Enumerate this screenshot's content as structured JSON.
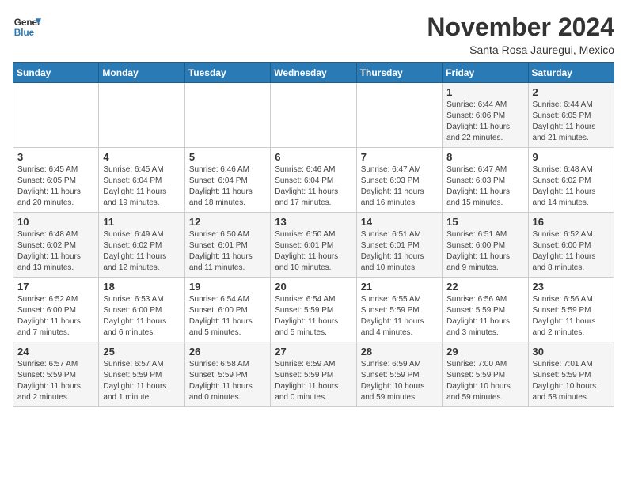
{
  "logo": {
    "general": "General",
    "blue": "Blue"
  },
  "title": "November 2024",
  "location": "Santa Rosa Jauregui, Mexico",
  "headers": [
    "Sunday",
    "Monday",
    "Tuesday",
    "Wednesday",
    "Thursday",
    "Friday",
    "Saturday"
  ],
  "weeks": [
    [
      {
        "day": "",
        "info": ""
      },
      {
        "day": "",
        "info": ""
      },
      {
        "day": "",
        "info": ""
      },
      {
        "day": "",
        "info": ""
      },
      {
        "day": "",
        "info": ""
      },
      {
        "day": "1",
        "info": "Sunrise: 6:44 AM\nSunset: 6:06 PM\nDaylight: 11 hours\nand 22 minutes."
      },
      {
        "day": "2",
        "info": "Sunrise: 6:44 AM\nSunset: 6:05 PM\nDaylight: 11 hours\nand 21 minutes."
      }
    ],
    [
      {
        "day": "3",
        "info": "Sunrise: 6:45 AM\nSunset: 6:05 PM\nDaylight: 11 hours\nand 20 minutes."
      },
      {
        "day": "4",
        "info": "Sunrise: 6:45 AM\nSunset: 6:04 PM\nDaylight: 11 hours\nand 19 minutes."
      },
      {
        "day": "5",
        "info": "Sunrise: 6:46 AM\nSunset: 6:04 PM\nDaylight: 11 hours\nand 18 minutes."
      },
      {
        "day": "6",
        "info": "Sunrise: 6:46 AM\nSunset: 6:04 PM\nDaylight: 11 hours\nand 17 minutes."
      },
      {
        "day": "7",
        "info": "Sunrise: 6:47 AM\nSunset: 6:03 PM\nDaylight: 11 hours\nand 16 minutes."
      },
      {
        "day": "8",
        "info": "Sunrise: 6:47 AM\nSunset: 6:03 PM\nDaylight: 11 hours\nand 15 minutes."
      },
      {
        "day": "9",
        "info": "Sunrise: 6:48 AM\nSunset: 6:02 PM\nDaylight: 11 hours\nand 14 minutes."
      }
    ],
    [
      {
        "day": "10",
        "info": "Sunrise: 6:48 AM\nSunset: 6:02 PM\nDaylight: 11 hours\nand 13 minutes."
      },
      {
        "day": "11",
        "info": "Sunrise: 6:49 AM\nSunset: 6:02 PM\nDaylight: 11 hours\nand 12 minutes."
      },
      {
        "day": "12",
        "info": "Sunrise: 6:50 AM\nSunset: 6:01 PM\nDaylight: 11 hours\nand 11 minutes."
      },
      {
        "day": "13",
        "info": "Sunrise: 6:50 AM\nSunset: 6:01 PM\nDaylight: 11 hours\nand 10 minutes."
      },
      {
        "day": "14",
        "info": "Sunrise: 6:51 AM\nSunset: 6:01 PM\nDaylight: 11 hours\nand 10 minutes."
      },
      {
        "day": "15",
        "info": "Sunrise: 6:51 AM\nSunset: 6:00 PM\nDaylight: 11 hours\nand 9 minutes."
      },
      {
        "day": "16",
        "info": "Sunrise: 6:52 AM\nSunset: 6:00 PM\nDaylight: 11 hours\nand 8 minutes."
      }
    ],
    [
      {
        "day": "17",
        "info": "Sunrise: 6:52 AM\nSunset: 6:00 PM\nDaylight: 11 hours\nand 7 minutes."
      },
      {
        "day": "18",
        "info": "Sunrise: 6:53 AM\nSunset: 6:00 PM\nDaylight: 11 hours\nand 6 minutes."
      },
      {
        "day": "19",
        "info": "Sunrise: 6:54 AM\nSunset: 6:00 PM\nDaylight: 11 hours\nand 5 minutes."
      },
      {
        "day": "20",
        "info": "Sunrise: 6:54 AM\nSunset: 5:59 PM\nDaylight: 11 hours\nand 5 minutes."
      },
      {
        "day": "21",
        "info": "Sunrise: 6:55 AM\nSunset: 5:59 PM\nDaylight: 11 hours\nand 4 minutes."
      },
      {
        "day": "22",
        "info": "Sunrise: 6:56 AM\nSunset: 5:59 PM\nDaylight: 11 hours\nand 3 minutes."
      },
      {
        "day": "23",
        "info": "Sunrise: 6:56 AM\nSunset: 5:59 PM\nDaylight: 11 hours\nand 2 minutes."
      }
    ],
    [
      {
        "day": "24",
        "info": "Sunrise: 6:57 AM\nSunset: 5:59 PM\nDaylight: 11 hours\nand 2 minutes."
      },
      {
        "day": "25",
        "info": "Sunrise: 6:57 AM\nSunset: 5:59 PM\nDaylight: 11 hours\nand 1 minute."
      },
      {
        "day": "26",
        "info": "Sunrise: 6:58 AM\nSunset: 5:59 PM\nDaylight: 11 hours\nand 0 minutes."
      },
      {
        "day": "27",
        "info": "Sunrise: 6:59 AM\nSunset: 5:59 PM\nDaylight: 11 hours\nand 0 minutes."
      },
      {
        "day": "28",
        "info": "Sunrise: 6:59 AM\nSunset: 5:59 PM\nDaylight: 10 hours\nand 59 minutes."
      },
      {
        "day": "29",
        "info": "Sunrise: 7:00 AM\nSunset: 5:59 PM\nDaylight: 10 hours\nand 59 minutes."
      },
      {
        "day": "30",
        "info": "Sunrise: 7:01 AM\nSunset: 5:59 PM\nDaylight: 10 hours\nand 58 minutes."
      }
    ]
  ]
}
